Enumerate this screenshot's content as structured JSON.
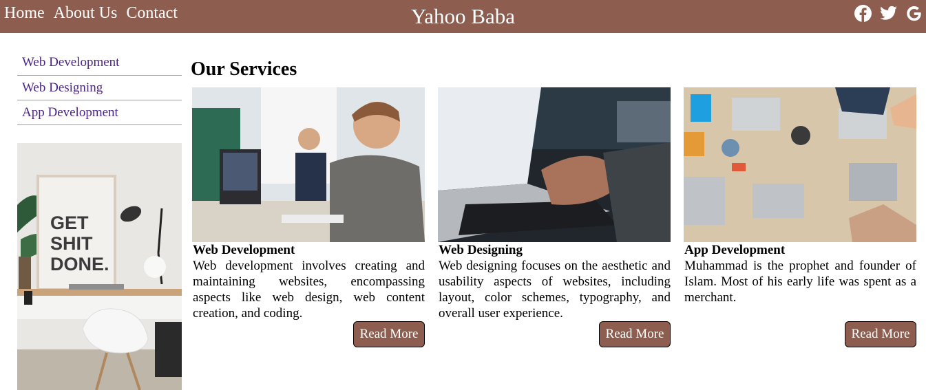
{
  "header": {
    "nav": [
      {
        "label": "Home"
      },
      {
        "label": "About Us"
      },
      {
        "label": "Contact"
      }
    ],
    "brand": "Yahoo Baba",
    "social_icons": [
      "facebook-icon",
      "twitter-icon",
      "google-icon"
    ]
  },
  "sidebar": {
    "links": [
      {
        "label": "Web Development"
      },
      {
        "label": "Web Designing"
      },
      {
        "label": "App Development"
      }
    ],
    "image_text": [
      "GET",
      "SHIT",
      "DONE."
    ]
  },
  "main": {
    "title": "Our Services",
    "cards": [
      {
        "title": "Web Development",
        "description": "Web development involves creating and maintaining websites, encompassing aspects like web design, web content creation, and coding.",
        "button": "Read More"
      },
      {
        "title": "Web Designing",
        "description": "Web designing focuses on the aesthetic and usability aspects of websites, including layout, color schemes, typography, and overall user experience.",
        "button": "Read More"
      },
      {
        "title": "App Development",
        "description": "Muhammad is the prophet and founder of Islam. Most of his early life was spent as a merchant.",
        "button": "Read More"
      }
    ]
  },
  "colors": {
    "header_bg": "#8d5e4f",
    "button_bg": "#8d5e4f",
    "sidebar_link": "#4b2586"
  }
}
